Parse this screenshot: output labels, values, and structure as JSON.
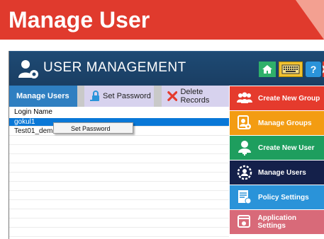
{
  "page": {
    "title": "Manage User"
  },
  "app": {
    "title": "USER MANAGEMENT",
    "header_icons": [
      "home-icon",
      "keyboard-icon",
      "help-icon",
      "close-icon"
    ],
    "help_glyph": "?"
  },
  "toolbar": {
    "manage_users": "Manage Users",
    "set_password": "Set Password",
    "delete_records": "Delete Records"
  },
  "grid": {
    "column_header": "Login Name",
    "rows": [
      {
        "login": "gokul1",
        "selected": true
      },
      {
        "login": "Test01_demo",
        "selected": false
      }
    ]
  },
  "context_menu": {
    "items": [
      "Set Password"
    ]
  },
  "sidebar": {
    "items": [
      {
        "label": "Create New Group",
        "icon": "group-add-icon",
        "color": "#e53b2d"
      },
      {
        "label": "Manage Groups",
        "icon": "manage-groups-icon",
        "color": "#f39c12"
      },
      {
        "label": "Create New User",
        "icon": "user-add-icon",
        "color": "#1e9e5e"
      },
      {
        "label": "Manage Users",
        "icon": "gear-user-icon",
        "color": "#14204a"
      },
      {
        "label": "Policy Settings",
        "icon": "policy-icon",
        "color": "#2a93d9"
      },
      {
        "label": "Application Settings",
        "icon": "app-settings-icon",
        "color": "#d86a79"
      }
    ]
  },
  "colors": {
    "title_band": "#e03a2d",
    "header_bg": "#1e4a74",
    "selection": "#0a78d7"
  }
}
